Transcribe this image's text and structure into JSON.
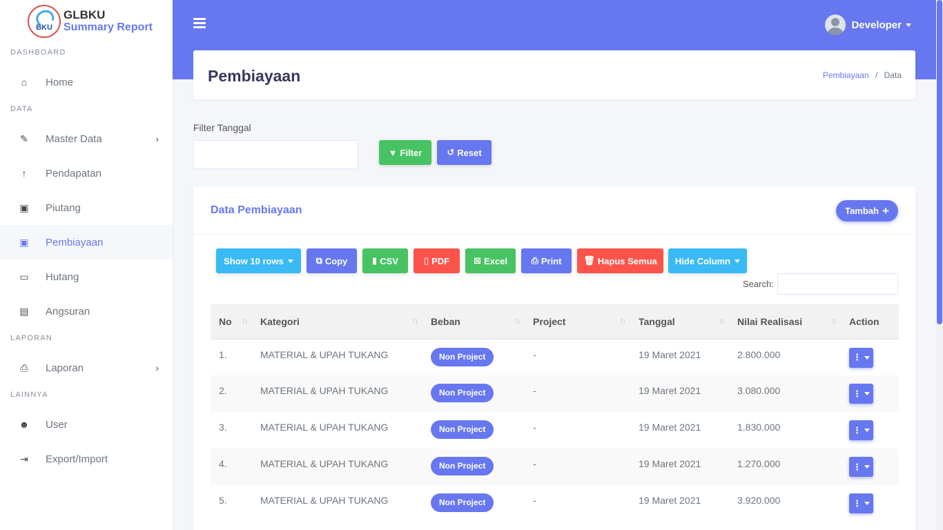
{
  "brand": {
    "logo_text": "BKU",
    "name": "GLBKU",
    "subtitle": "Summary Report"
  },
  "sidebar": {
    "sections": [
      {
        "header": "DASHBOARD",
        "items": [
          {
            "label": "Home",
            "icon": "home-icon",
            "glyph": "🏠"
          }
        ]
      },
      {
        "header": "DATA",
        "items": [
          {
            "label": "Master Data",
            "icon": "edit-icon",
            "glyph": "✎"
          },
          {
            "label": "Pendapatan",
            "icon": "arrow-up-icon",
            "glyph": "↑"
          },
          {
            "label": "Piutang",
            "icon": "money-icon",
            "glyph": "💵"
          },
          {
            "label": "Pembiayaan",
            "icon": "money-bill-icon",
            "glyph": "💵"
          },
          {
            "label": "Hutang",
            "icon": "credit-card-icon",
            "glyph": "▭"
          },
          {
            "label": "Angsuran",
            "icon": "id-card-icon",
            "glyph": "▤"
          }
        ]
      },
      {
        "header": "LAPORAN",
        "items": [
          {
            "label": "Laporan",
            "icon": "print-icon",
            "glyph": "⎙"
          }
        ]
      },
      {
        "header": "LAINNYA",
        "items": [
          {
            "label": "User",
            "icon": "users-icon",
            "glyph": "👥"
          },
          {
            "label": "Export/Import",
            "icon": "file-export-icon",
            "glyph": "⇥"
          }
        ]
      }
    ],
    "active_item": "Pembiayaan"
  },
  "topbar": {
    "user_name": "Developer"
  },
  "page": {
    "title": "Pembiayaan",
    "breadcrumb": [
      "Pembiayaan",
      "Data"
    ]
  },
  "filter": {
    "label": "Filter Tanggal",
    "input_value": "",
    "filter_label": "Filter",
    "reset_label": "Reset"
  },
  "card": {
    "title": "Data Pembiayaan",
    "add_label": "Tambah",
    "toolbar": {
      "show_rows": "Show 10 rows",
      "copy": "Copy",
      "csv": "CSV",
      "pdf": "PDF",
      "excel": "Excel",
      "print": "Print",
      "hapus": "Hapus Semua",
      "hide_column": "Hide Column"
    },
    "search_label": "Search:",
    "search_value": ""
  },
  "table": {
    "columns": [
      "No",
      "Kategori",
      "Beban",
      "Project",
      "Tanggal",
      "Nilai Realisasi",
      "Action"
    ],
    "rows": [
      {
        "no": "1.",
        "kategori": "MATERIAL & UPAH TUKANG",
        "beban": "Non Project",
        "project": "-",
        "tanggal": "19 Maret 2021",
        "nilai": "2.800.000"
      },
      {
        "no": "2.",
        "kategori": "MATERIAL & UPAH TUKANG",
        "beban": "Non Project",
        "project": "-",
        "tanggal": "19 Maret 2021",
        "nilai": "3.080.000"
      },
      {
        "no": "3.",
        "kategori": "MATERIAL & UPAH TUKANG",
        "beban": "Non Project",
        "project": "-",
        "tanggal": "19 Maret 2021",
        "nilai": "1.830.000"
      },
      {
        "no": "4.",
        "kategori": "MATERIAL & UPAH TUKANG",
        "beban": "Non Project",
        "project": "-",
        "tanggal": "19 Maret 2021",
        "nilai": "1.270.000"
      },
      {
        "no": "5.",
        "kategori": "MATERIAL & UPAH TUKANG",
        "beban": "Non Project",
        "project": "-",
        "tanggal": "19 Maret 2021",
        "nilai": "3.920.000"
      }
    ]
  },
  "colors": {
    "primary": "#6777ef",
    "success": "#47c363",
    "danger": "#fc544b",
    "info": "#3abaf4"
  }
}
